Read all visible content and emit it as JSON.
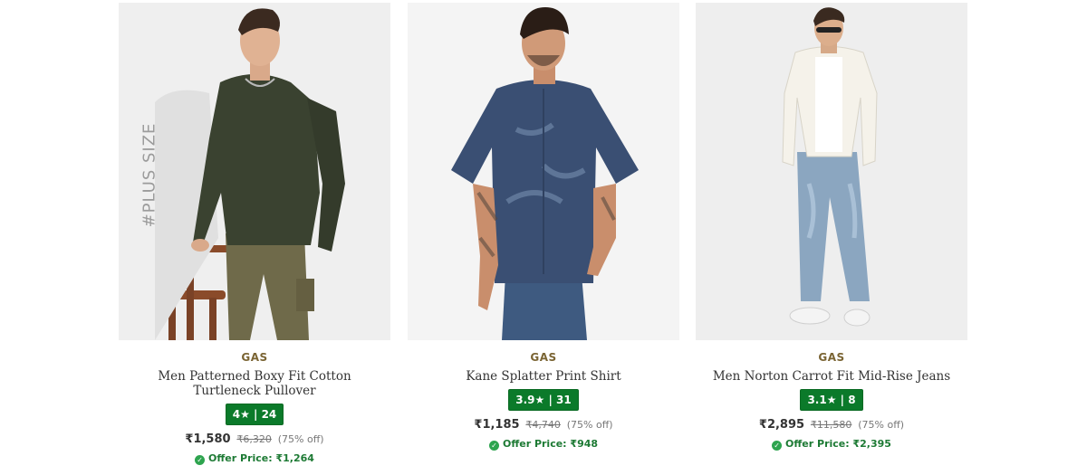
{
  "products": [
    {
      "badge": "#PLUS SIZE",
      "brand": "GAS",
      "title": "Men Patterned Boxy Fit Cotton Turtleneck Pullover",
      "rating": "4★ | 24",
      "price": "₹1,580",
      "mrp": "₹6,320",
      "discount": "(75% off)",
      "offer_label": "Offer Price: ₹1,264"
    },
    {
      "brand": "GAS",
      "title": "Kane Splatter Print Shirt",
      "rating": "3.9★ | 31",
      "price": "₹1,185",
      "mrp": "₹4,740",
      "discount": "(75% off)",
      "offer_label": "Offer Price: ₹948"
    },
    {
      "brand": "GAS",
      "title": "Men Norton Carrot Fit Mid-Rise Jeans",
      "rating": "3.1★ | 8",
      "price": "₹2,895",
      "mrp": "₹11,580",
      "discount": "(75% off)",
      "offer_label": "Offer Price: ₹2,395"
    }
  ],
  "colors": {
    "rating_bg": "#0b7a2a",
    "brand": "#7a6433",
    "offer": "#1d7a34"
  },
  "icons": {
    "offer": "offer-tag-icon"
  }
}
